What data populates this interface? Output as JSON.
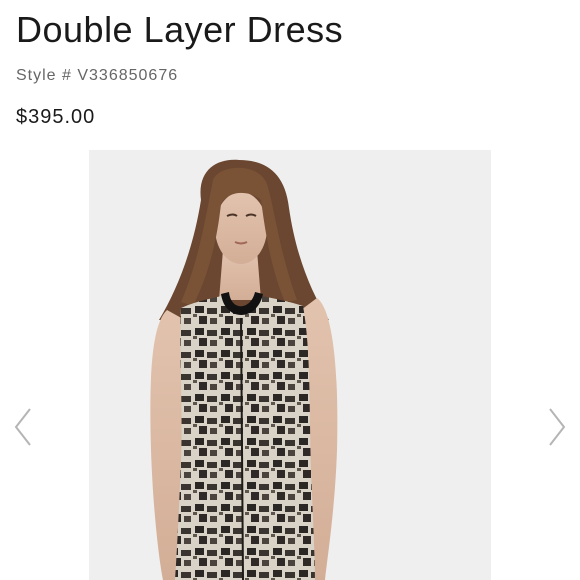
{
  "product": {
    "title": "Double Layer Dress",
    "style_label": "Style # V336850676",
    "price": "$395.00"
  },
  "gallery": {
    "image_alt": "Model wearing a sleeveless black and cream abstract print dress",
    "prev_icon": "chevron-left-icon",
    "next_icon": "chevron-right-icon"
  },
  "colors": {
    "text": "#1a1a1a",
    "muted": "#666666",
    "image_bg": "#eeeeee",
    "arrow": "#b5b5b5"
  }
}
